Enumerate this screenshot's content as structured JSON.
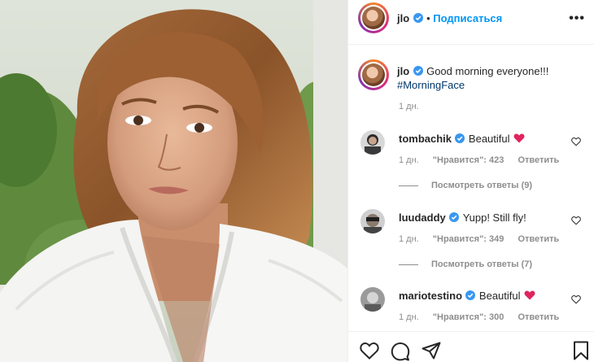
{
  "post": {
    "username": "jlo",
    "follow_label": "Подписаться",
    "more_label": "•••",
    "caption": "Good morning everyone!!!",
    "hashtag": "#MorningFace",
    "time": "1 дн."
  },
  "comments": [
    {
      "username": "tombachik",
      "text": "Beautiful",
      "time": "1 дн.",
      "likes": "\"Нравится\": 423",
      "reply": "Ответить",
      "view_replies": "Посмотреть ответы (9)"
    },
    {
      "username": "luudaddy",
      "text": "Yupp! Still fly!",
      "time": "1 дн.",
      "likes": "\"Нравится\": 349",
      "reply": "Ответить",
      "view_replies": "Посмотреть ответы (7)"
    },
    {
      "username": "mariotestino",
      "text": "Beautiful",
      "time": "1 дн.",
      "likes": "\"Нравится\": 300",
      "reply": "Ответить"
    }
  ],
  "icons": {
    "verified": "verified-badge-icon",
    "heart": "heart-icon",
    "comment": "comment-icon",
    "share": "share-icon",
    "save": "bookmark-icon"
  },
  "colors": {
    "accent": "#0095f6",
    "verified": "#3897f0",
    "heart_emoji": "#e0245e",
    "muted": "#8e8e8e",
    "hashtag": "#00376b"
  }
}
